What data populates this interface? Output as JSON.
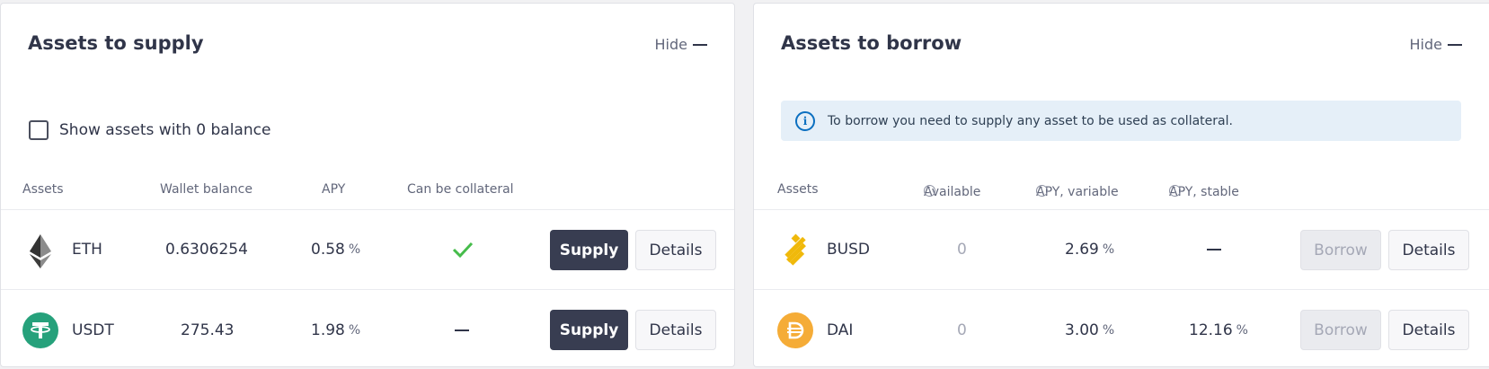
{
  "supply": {
    "title": "Assets to supply",
    "hide_label": "Hide",
    "zero_balance_label": "Show assets with 0 balance",
    "columns": [
      "Assets",
      "Wallet balance",
      "APY",
      "Can be collateral"
    ],
    "rows": [
      {
        "asset": "ETH",
        "icon": "eth-icon",
        "balance": "0.6306254",
        "apy": "0.58",
        "apy_unit": "%",
        "collateral": "check",
        "supply_label": "Supply",
        "details_label": "Details"
      },
      {
        "asset": "USDT",
        "icon": "usdt-icon",
        "balance": "275.43",
        "apy": "1.98",
        "apy_unit": "%",
        "collateral": "dash",
        "supply_label": "Supply",
        "details_label": "Details"
      }
    ]
  },
  "borrow": {
    "title": "Assets to borrow",
    "hide_label": "Hide",
    "info_text": "To borrow you need to supply any asset to be used as collateral.",
    "columns": [
      "Assets",
      "Available",
      "APY, variable",
      "APY, stable"
    ],
    "rows": [
      {
        "asset": "BUSD",
        "icon": "busd-icon",
        "available": "0",
        "apy_variable": "2.69",
        "apy_variable_unit": "%",
        "apy_stable": "",
        "apy_stable_unit": "",
        "borrow_label": "Borrow",
        "details_label": "Details"
      },
      {
        "asset": "DAI",
        "icon": "dai-icon",
        "available": "0",
        "apy_variable": "3.00",
        "apy_variable_unit": "%",
        "apy_stable": "12.16",
        "apy_stable_unit": "%",
        "borrow_label": "Borrow",
        "details_label": "Details"
      }
    ]
  },
  "colors": {
    "primary_button": "#383d51",
    "info_background": "#e5eff8",
    "check": "#46bc4b",
    "usdt": "#26a17b",
    "busd": "#f0b90b",
    "dai": "#f5ac37"
  }
}
